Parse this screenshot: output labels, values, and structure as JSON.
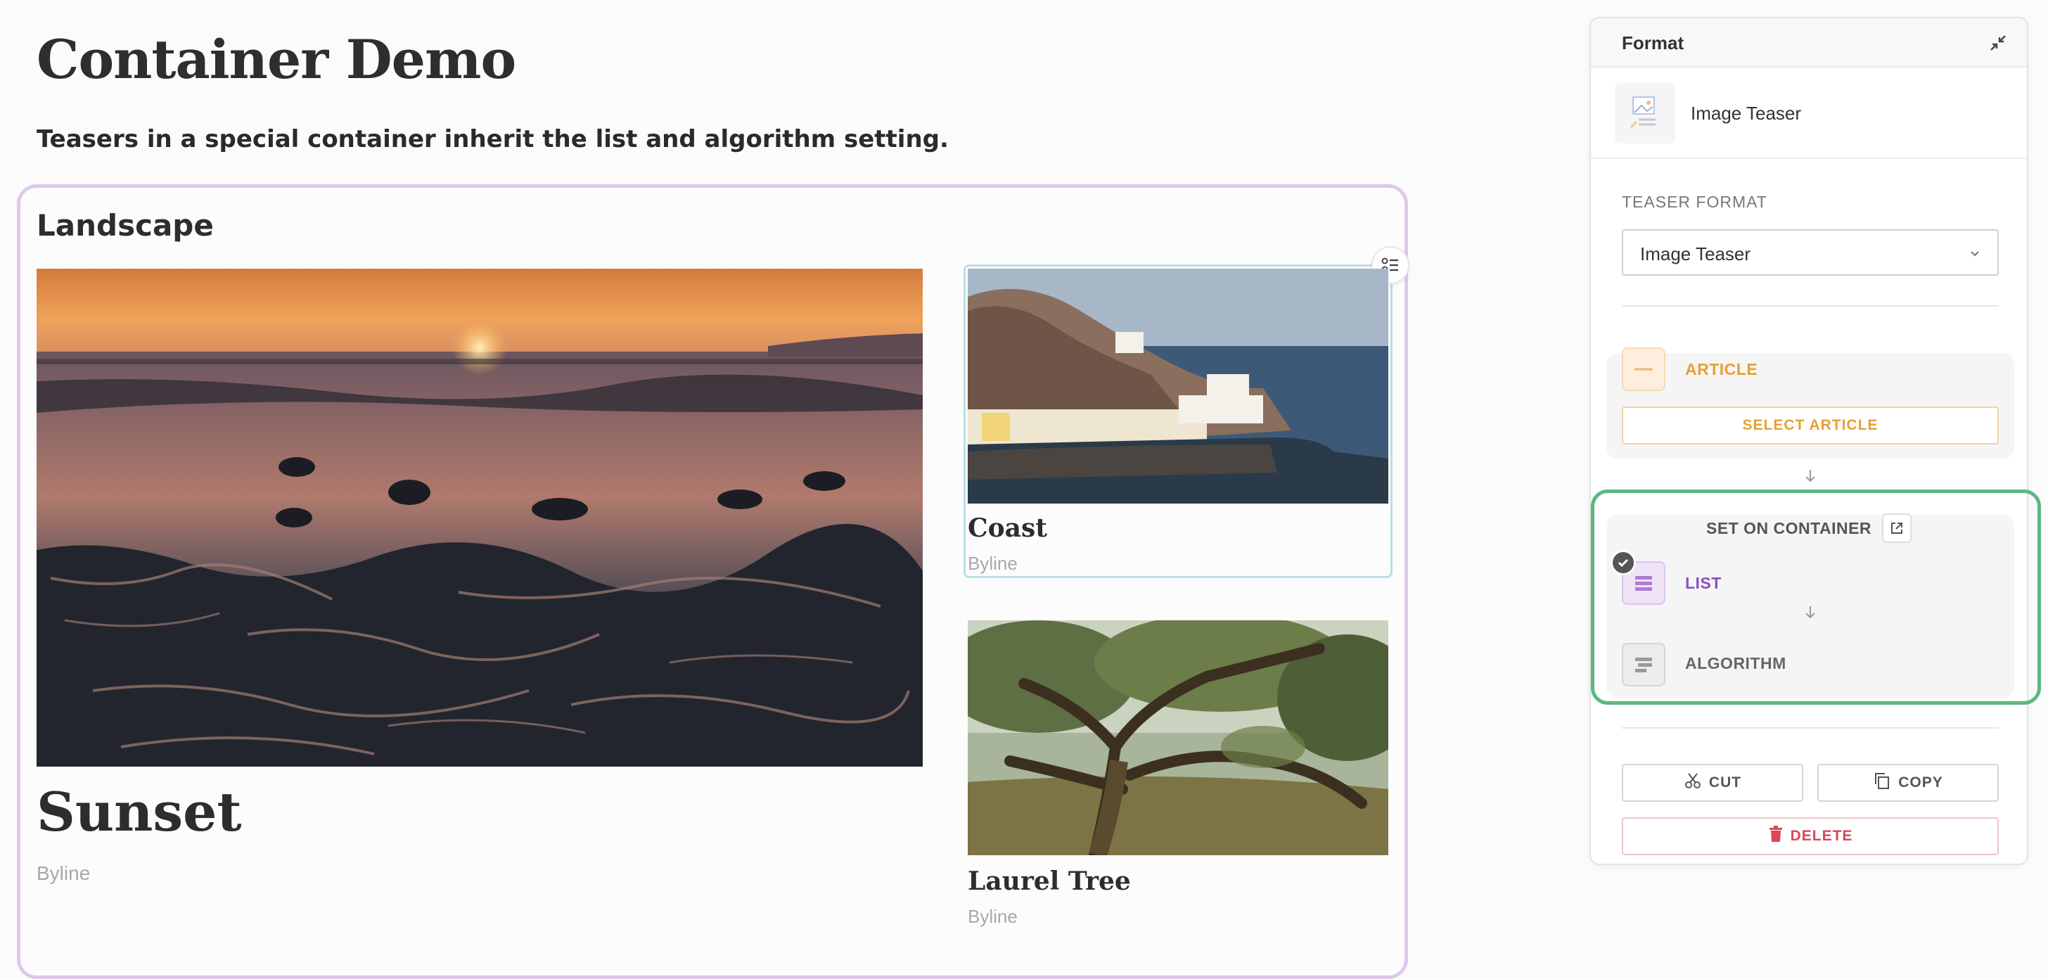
{
  "page": {
    "title": "Container Demo",
    "subtitle": "Teasers in a special container inherit the list and algorithm setting."
  },
  "container": {
    "title": "Landscape",
    "teasers": [
      {
        "title": "Sunset",
        "byline": "Byline"
      },
      {
        "title": "Coast",
        "byline": "Byline"
      },
      {
        "title": "Laurel Tree",
        "byline": "Byline"
      }
    ]
  },
  "panel": {
    "title": "Format",
    "type_name": "Image Teaser",
    "teaser_format_label": "TEASER FORMAT",
    "teaser_format_value": "Image Teaser",
    "article_label": "ARTICLE",
    "select_article_label": "SELECT ARTICLE",
    "set_on_container_label": "SET ON CONTAINER",
    "list_label": "LIST",
    "algorithm_label": "ALGORITHM",
    "cut_label": "CUT",
    "copy_label": "COPY",
    "delete_label": "DELETE"
  },
  "colors": {
    "container_border": "#ddc8ea",
    "selected_teaser_border": "#b6e0e6",
    "highlight_frame": "#5bb880",
    "article_accent": "#e6a034",
    "list_accent": "#8c4fc2",
    "delete_accent": "#d9475a"
  },
  "icons": [
    "collapse-icon",
    "image-teaser-icon",
    "chevron-down-icon",
    "article-icon",
    "arrow-down-icon",
    "external-link-icon",
    "check-icon",
    "list-icon",
    "algorithm-icon",
    "scissors-icon",
    "copy-icon",
    "trash-icon",
    "teaser-options-icon"
  ]
}
